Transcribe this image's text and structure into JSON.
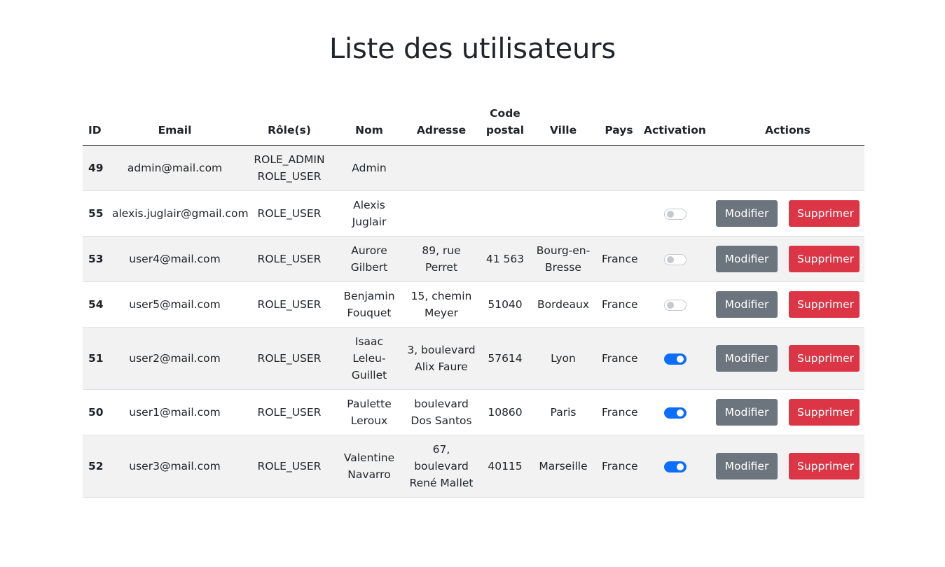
{
  "page": {
    "title": "Liste des utilisateurs"
  },
  "colors": {
    "text": "#212529",
    "stripe": "#f2f2f2",
    "secondary_button": "#6c757d",
    "danger_button": "#dc3545",
    "switch_on": "#0d6efd",
    "switch_off": "#c6cacd"
  },
  "table": {
    "headers": {
      "id": "ID",
      "email": "Email",
      "roles": "Rôle(s)",
      "nom": "Nom",
      "adresse": "Adresse",
      "code_postal": [
        "Code",
        "postal"
      ],
      "ville": "Ville",
      "pays": "Pays",
      "activation": "Activation",
      "actions": "Actions"
    },
    "rows": [
      {
        "id": "49",
        "email": "admin@mail.com",
        "roles": [
          "ROLE_ADMIN",
          "ROLE_USER"
        ],
        "nom": [
          "Admin"
        ],
        "adresse": [],
        "code_postal": "",
        "ville": [],
        "pays": "",
        "activation": null,
        "actions": null
      },
      {
        "id": "55",
        "email": "alexis.juglair@gmail.com",
        "roles": [
          "ROLE_USER"
        ],
        "nom": [
          "Alexis",
          "Juglair"
        ],
        "adresse": [],
        "code_postal": "",
        "ville": [],
        "pays": "",
        "activation": false,
        "actions": {
          "edit": "Modifier",
          "delete": "Supprimer"
        }
      },
      {
        "id": "53",
        "email": "user4@mail.com",
        "roles": [
          "ROLE_USER"
        ],
        "nom": [
          "Aurore",
          "Gilbert"
        ],
        "adresse": [
          "89, rue",
          "Perret"
        ],
        "code_postal": "41 563",
        "ville": [
          "Bourg-en-",
          "Bresse"
        ],
        "pays": "France",
        "activation": false,
        "actions": {
          "edit": "Modifier",
          "delete": "Supprimer"
        }
      },
      {
        "id": "54",
        "email": "user5@mail.com",
        "roles": [
          "ROLE_USER"
        ],
        "nom": [
          "Benjamin",
          "Fouquet"
        ],
        "adresse": [
          "15, chemin",
          "Meyer"
        ],
        "code_postal": "51040",
        "ville": [
          "Bordeaux"
        ],
        "pays": "France",
        "activation": false,
        "actions": {
          "edit": "Modifier",
          "delete": "Supprimer"
        }
      },
      {
        "id": "51",
        "email": "user2@mail.com",
        "roles": [
          "ROLE_USER"
        ],
        "nom": [
          "Isaac",
          "Leleu-",
          "Guillet"
        ],
        "adresse": [
          "3, boulevard",
          "Alix Faure"
        ],
        "code_postal": "57614",
        "ville": [
          "Lyon"
        ],
        "pays": "France",
        "activation": true,
        "actions": {
          "edit": "Modifier",
          "delete": "Supprimer"
        }
      },
      {
        "id": "50",
        "email": "user1@mail.com",
        "roles": [
          "ROLE_USER"
        ],
        "nom": [
          "Paulette",
          "Leroux"
        ],
        "adresse": [
          "boulevard",
          "Dos Santos"
        ],
        "code_postal": "10860",
        "ville": [
          "Paris"
        ],
        "pays": "France",
        "activation": true,
        "actions": {
          "edit": "Modifier",
          "delete": "Supprimer"
        }
      },
      {
        "id": "52",
        "email": "user3@mail.com",
        "roles": [
          "ROLE_USER"
        ],
        "nom": [
          "Valentine",
          "Navarro"
        ],
        "adresse": [
          "67,",
          "boulevard",
          "René Mallet"
        ],
        "code_postal": "40115",
        "ville": [
          "Marseille"
        ],
        "pays": "France",
        "activation": true,
        "actions": {
          "edit": "Modifier",
          "delete": "Supprimer"
        }
      }
    ]
  }
}
